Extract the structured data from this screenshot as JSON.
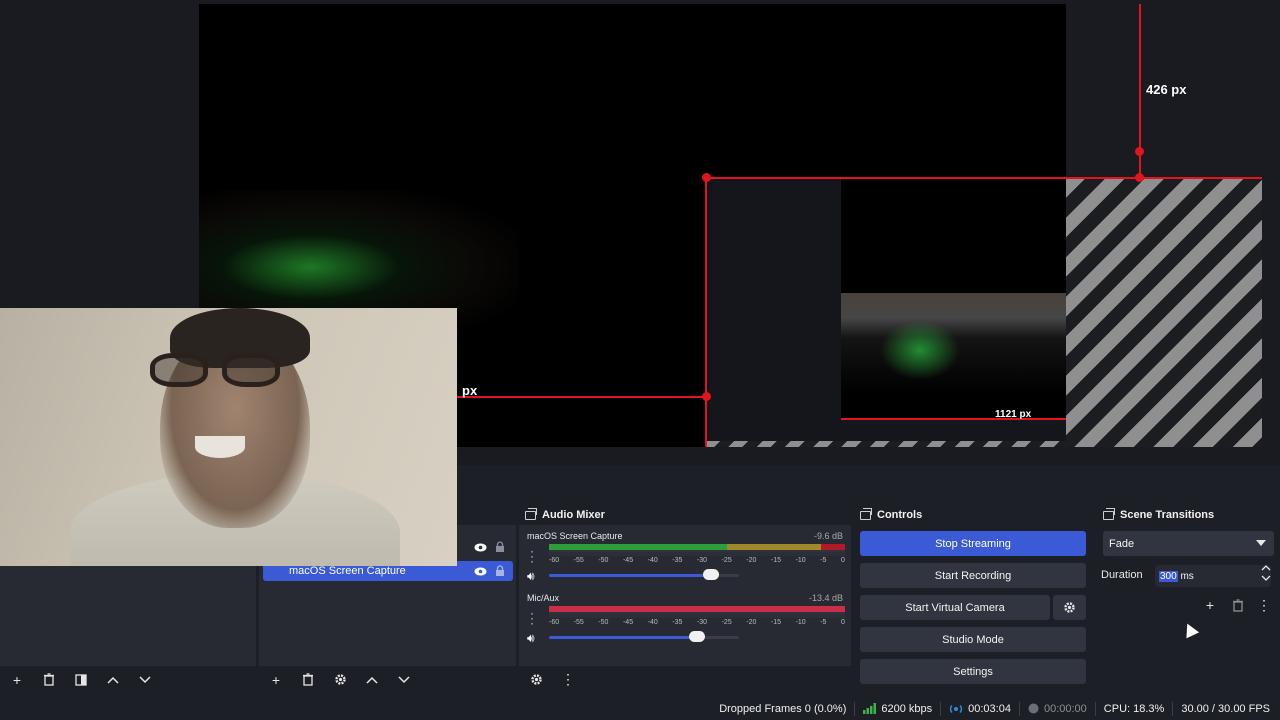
{
  "preview": {
    "measure_top": "426 px",
    "measure_left": "px",
    "measure_inner": "1121 px"
  },
  "sources": {
    "items": [
      {
        "label": ""
      },
      {
        "label": "macOS Screen Capture"
      }
    ]
  },
  "audio_mixer": {
    "title": "Audio Mixer",
    "channels": [
      {
        "name": "macOS Screen Capture",
        "db": "-9.6 dB",
        "volume": 0.85,
        "level": 0.92
      },
      {
        "name": "Mic/Aux",
        "db": "-13.4 dB",
        "volume": 0.78,
        "level": 1.0
      }
    ],
    "ticks": [
      "-60",
      "-55",
      "-50",
      "-45",
      "-40",
      "-35",
      "-30",
      "-25",
      "-20",
      "-15",
      "-10",
      "-5",
      "0"
    ]
  },
  "controls": {
    "title": "Controls",
    "stop_streaming": "Stop Streaming",
    "start_recording": "Start Recording",
    "start_virtual_camera": "Start Virtual Camera",
    "studio_mode": "Studio Mode",
    "settings": "Settings"
  },
  "scene_transitions": {
    "title": "Scene Transitions",
    "selected": "Fade",
    "duration_label": "Duration",
    "duration_value": "300",
    "duration_unit": "ms"
  },
  "status": {
    "dropped_frames": "Dropped Frames 0 (0.0%)",
    "bitrate": "6200 kbps",
    "stream_time": "00:03:04",
    "record_time": "00:00:00",
    "cpu": "CPU: 18.3%",
    "fps": "30.00 / 30.00 FPS"
  },
  "colors": {
    "accent": "#3b5ad6",
    "guide": "#e2141c",
    "meter_green": "#2e9e3a",
    "meter_yellow": "#9e8a2a",
    "meter_red": "#b21a2a"
  }
}
